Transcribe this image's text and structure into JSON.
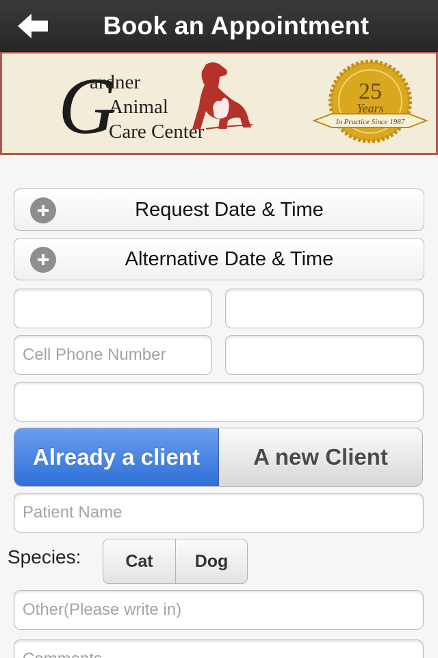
{
  "nav": {
    "title": "Book an Appointment",
    "back_icon": "back-arrow-icon"
  },
  "banner": {
    "logo_initial": "G",
    "logo_line1": "ardner",
    "logo_line2": "Animal",
    "logo_line3": "Care Center",
    "seal_number": "25",
    "seal_years": "Years",
    "seal_ribbon": "In Practice Since 1987",
    "colors": {
      "dog": "#b4322a",
      "seal": "#d9a81e",
      "border": "#b4574d"
    }
  },
  "form": {
    "request_label": "Request Date & Time",
    "alternative_label": "Alternative Date & Time",
    "expander_icon": "plus-circle-icon",
    "first_name": {
      "value": "",
      "placeholder": ""
    },
    "last_name": {
      "value": "",
      "placeholder": ""
    },
    "cell_phone": {
      "value": "",
      "placeholder": "Cell Phone Number"
    },
    "other_phone": {
      "value": "",
      "placeholder": ""
    },
    "email": {
      "value": "",
      "placeholder": ""
    },
    "client_toggle": {
      "options": [
        "Already a client",
        "A new Client"
      ],
      "selected": "Already a client"
    },
    "patient_name": {
      "value": "",
      "placeholder": "Patient Name"
    },
    "species": {
      "label": "Species:",
      "options": [
        "Cat",
        "Dog"
      ]
    },
    "other_species": {
      "value": "",
      "placeholder": "Other(Please write in)"
    },
    "comments": {
      "value": "",
      "placeholder": "Comments"
    }
  },
  "colors": {
    "nav_bg": "#2f2f2f",
    "segment_selected": "#3d7be0",
    "page_bg": "#f6f6f6"
  }
}
